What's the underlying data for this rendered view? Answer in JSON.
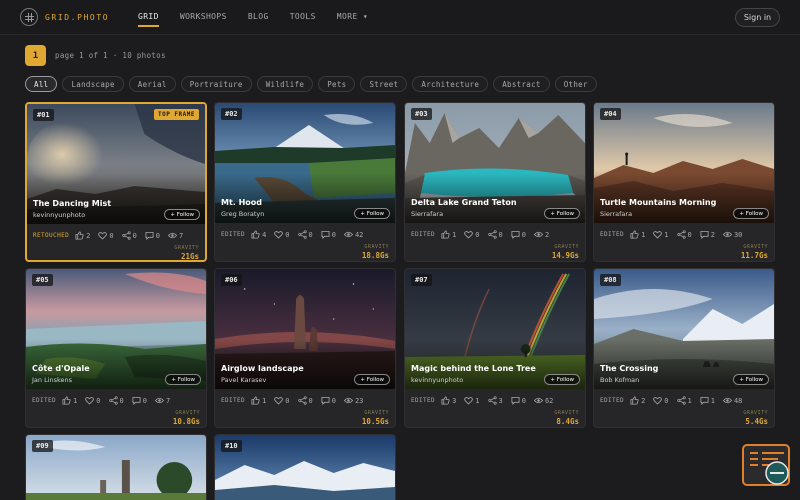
{
  "brand": {
    "name": "GRID.PHOTO"
  },
  "nav": [
    {
      "label": "GRID",
      "active": true
    },
    {
      "label": "WORKSHOPS",
      "active": false
    },
    {
      "label": "BLOG",
      "active": false
    },
    {
      "label": "TOOLS",
      "active": false
    },
    {
      "label": "MORE ▾",
      "active": false
    }
  ],
  "auth": {
    "sign_in": "Sign in"
  },
  "pagination": {
    "current": "1",
    "info": "page 1 of 1 · 10 photos"
  },
  "filters": [
    "All",
    "Landscape",
    "Aerial",
    "Portraiture",
    "Wildlife",
    "Pets",
    "Street",
    "Architecture",
    "Abstract",
    "Other"
  ],
  "active_filter": "All",
  "colors": {
    "accent": "#e0a830",
    "background": "#1c1c1e",
    "card": "#262628"
  },
  "photos": [
    {
      "num": "#01",
      "badge": "TOP FRAME",
      "title": "The Dancing Mist",
      "author": "kevinnyunphoto",
      "status": "RETOUCHED",
      "likes": "2",
      "hearts": "0",
      "shares": "0",
      "comments": "0",
      "views": "7",
      "gravity_label": "GRAVITY",
      "gravity": "21Gs"
    },
    {
      "num": "#02",
      "title": "Mt. Hood",
      "author": "Greg Boratyn",
      "status": "EDITED",
      "likes": "4",
      "hearts": "0",
      "shares": "0",
      "comments": "0",
      "views": "42",
      "gravity_label": "GRAVITY",
      "gravity": "18.8Gs"
    },
    {
      "num": "#03",
      "title": "Delta Lake Grand Teton",
      "author": "Sierrafara",
      "status": "EDITED",
      "likes": "1",
      "hearts": "0",
      "shares": "0",
      "comments": "0",
      "views": "2",
      "gravity_label": "GRAVITY",
      "gravity": "14.9Gs"
    },
    {
      "num": "#04",
      "title": "Turtle Mountains Morning",
      "author": "Sierrafara",
      "status": "EDITED",
      "likes": "1",
      "hearts": "1",
      "shares": "0",
      "comments": "2",
      "views": "30",
      "gravity_label": "GRAVITY",
      "gravity": "11.7Gs"
    },
    {
      "num": "#05",
      "title": "Côte d'Opale",
      "author": "Jan Linskens",
      "status": "EDITED",
      "likes": "1",
      "hearts": "0",
      "shares": "0",
      "comments": "0",
      "views": "7",
      "gravity_label": "GRAVITY",
      "gravity": "10.8Gs"
    },
    {
      "num": "#06",
      "title": "Airglow landscape",
      "author": "Pavel Karasev",
      "status": "EDITED",
      "likes": "1",
      "hearts": "0",
      "shares": "0",
      "comments": "0",
      "views": "23",
      "gravity_label": "GRAVITY",
      "gravity": "10.5Gs"
    },
    {
      "num": "#07",
      "title": "Magic behind the Lone Tree",
      "author": "kevinnyunphoto",
      "status": "EDITED",
      "likes": "3",
      "hearts": "1",
      "shares": "3",
      "comments": "0",
      "views": "62",
      "gravity_label": "GRAVITY",
      "gravity": "8.4Gs"
    },
    {
      "num": "#08",
      "title": "The Crossing",
      "author": "Bob Kofman",
      "status": "EDITED",
      "likes": "2",
      "hearts": "0",
      "shares": "1",
      "comments": "1",
      "views": "48",
      "gravity_label": "GRAVITY",
      "gravity": "5.4Gs"
    },
    {
      "num": "#09"
    },
    {
      "num": "#10"
    }
  ],
  "follow_label": "+ Follow"
}
